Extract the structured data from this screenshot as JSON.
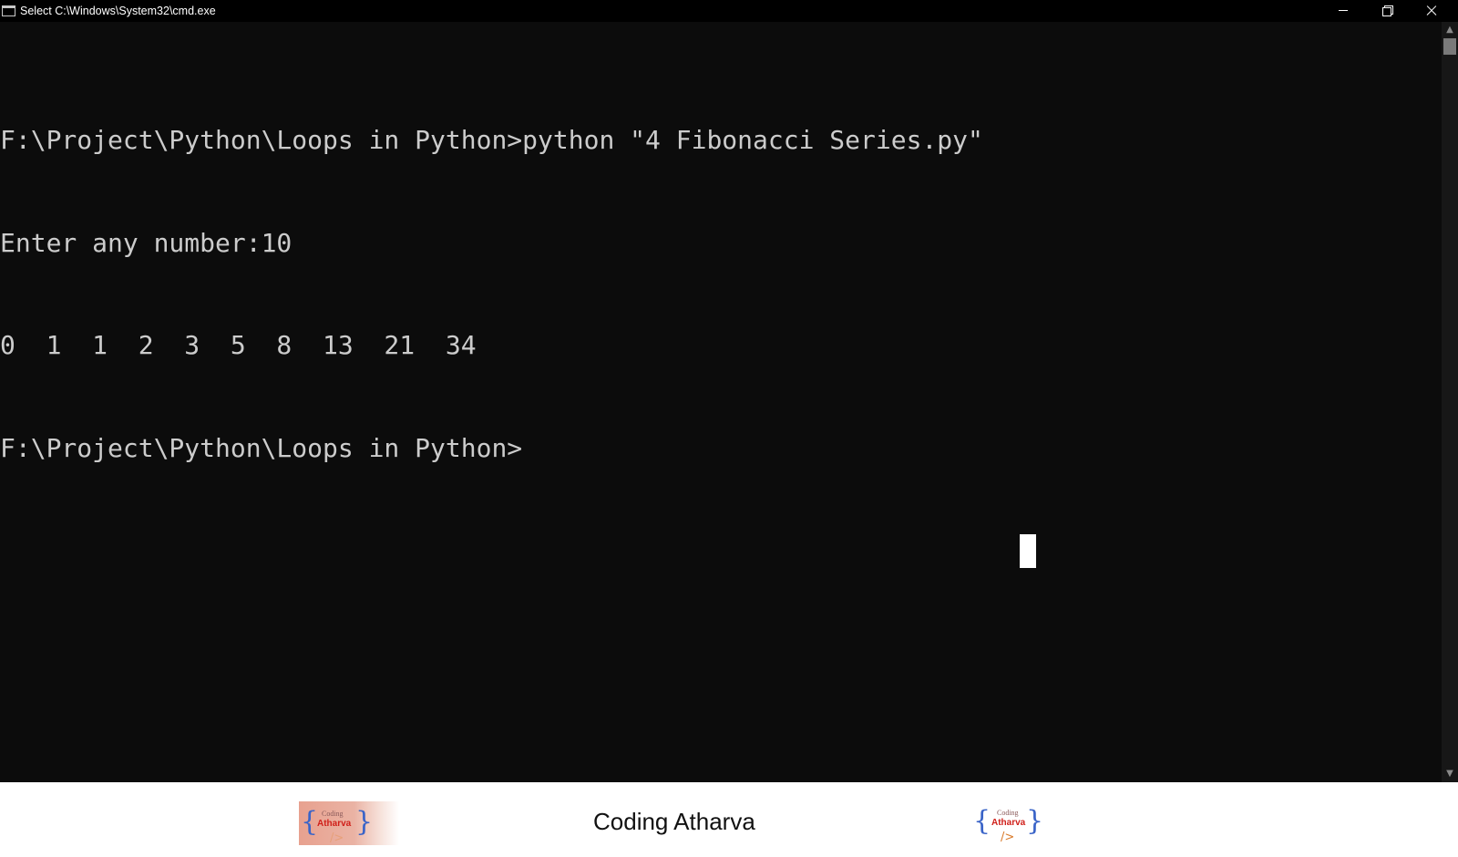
{
  "window": {
    "title": "Select C:\\Windows\\System32\\cmd.exe",
    "icon": "cmd-icon",
    "icon_text": "C:\\."
  },
  "title_buttons": {
    "minimize": "minimize-icon",
    "maximize": "restore-icon",
    "close": "close-icon"
  },
  "console": {
    "lines": [
      "F:\\Project\\Python\\Loops in Python>python \"4 Fibonacci Series.py\"",
      "Enter any number:10",
      "0  1  1  2  3  5  8  13  21  34",
      "F:\\Project\\Python\\Loops in Python>"
    ],
    "background": "#0c0c0c",
    "foreground": "#cccccc"
  },
  "scrollbar": {
    "up_arrow": "^",
    "down_arrow": "v"
  },
  "footer": {
    "title": "Coding Atharva",
    "logo_left": {
      "open_brace": "{",
      "small_text": "Coding",
      "bold_text": "Atharva",
      "close_brace": "}",
      "slash": "/>"
    },
    "logo_right": {
      "open_brace": "{",
      "small_text": "Coding",
      "bold_text": "Atharva",
      "close_brace": "}",
      "slash": "/>"
    }
  }
}
